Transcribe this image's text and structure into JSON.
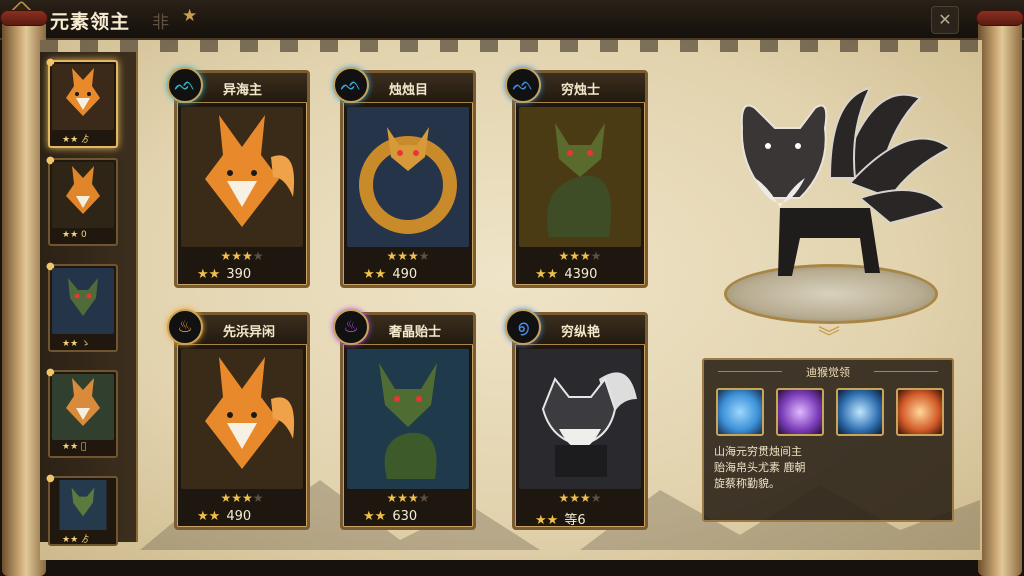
{
  "header": {
    "back_icon": "chevron-left-icon",
    "title": "元素领主",
    "glyph": "非",
    "star": "★",
    "close_icon": "x-icon",
    "close_symbol": "✕"
  },
  "sidebar": {
    "items": [
      {
        "rank": "★★ ゟ",
        "creature": "fox"
      },
      {
        "rank": "★★ 0",
        "creature": "fox"
      },
      {
        "rank": "★★ ゝ",
        "creature": "dragon"
      },
      {
        "rank": "★★ ゙",
        "creature": "fox"
      },
      {
        "rank": "★★ ゟ",
        "creature": "dragon"
      }
    ]
  },
  "cards": [
    {
      "name": "异海主",
      "element_icon": "water-drop-icon",
      "element_glyph": "ᨒ",
      "element_color": "#2fb7c9",
      "stars_on": 3,
      "stars_total": 4,
      "foot_stars": "★★",
      "power": "390",
      "creature": "fox"
    },
    {
      "name": "烛烛目",
      "element_icon": "water-drop-icon",
      "element_glyph": "ᨒ",
      "element_color": "#3aa5e0",
      "stars_on": 3,
      "stars_total": 4,
      "foot_stars": "★★",
      "power": "490",
      "creature": "dragon"
    },
    {
      "name": "穷烛士",
      "element_icon": "water-drop-icon",
      "element_glyph": "ᨒ",
      "element_color": "#3d8fe0",
      "stars_on": 3,
      "stars_total": 4,
      "foot_stars": "★★",
      "power": "4390",
      "creature": "dragon-gold"
    },
    {
      "name": "先浜异闲",
      "element_icon": "flame-icon",
      "element_glyph": "♨",
      "element_color": "#f0a030",
      "stars_on": 3,
      "stars_total": 4,
      "foot_stars": "★★",
      "power": "490",
      "creature": "fox"
    },
    {
      "name": "奢晶贻士",
      "element_icon": "arcane-flame-icon",
      "element_glyph": "♨",
      "element_color": "#b04ee6",
      "stars_on": 3,
      "stars_total": 4,
      "foot_stars": "★★",
      "power": "630",
      "creature": "dragon-green"
    },
    {
      "name": "穷纵艳",
      "element_icon": "wind-swirl-icon",
      "element_glyph": "൭",
      "element_color": "#4d8fe6",
      "stars_on": 3,
      "stars_total": 4,
      "foot_stars": "★★",
      "power": "等6",
      "creature": "wolf"
    }
  ],
  "preview": {
    "creature": "nine-tailed-wolf",
    "marker": "︾"
  },
  "skills": {
    "title": "迪猴觉领",
    "icons": [
      "ice-claw-skill-icon",
      "shadow-strike-skill-icon",
      "blue-beast-skill-icon",
      "fire-burst-skill-icon"
    ],
    "colors": [
      "#3a8fd6",
      "#7a3bb8",
      "#2f6fb0",
      "#d25a28"
    ],
    "description": [
      "山海元穷贯烛间主",
      "贻海帛头尤素 鹿朝",
      "旋蔡称勤貌。"
    ]
  }
}
